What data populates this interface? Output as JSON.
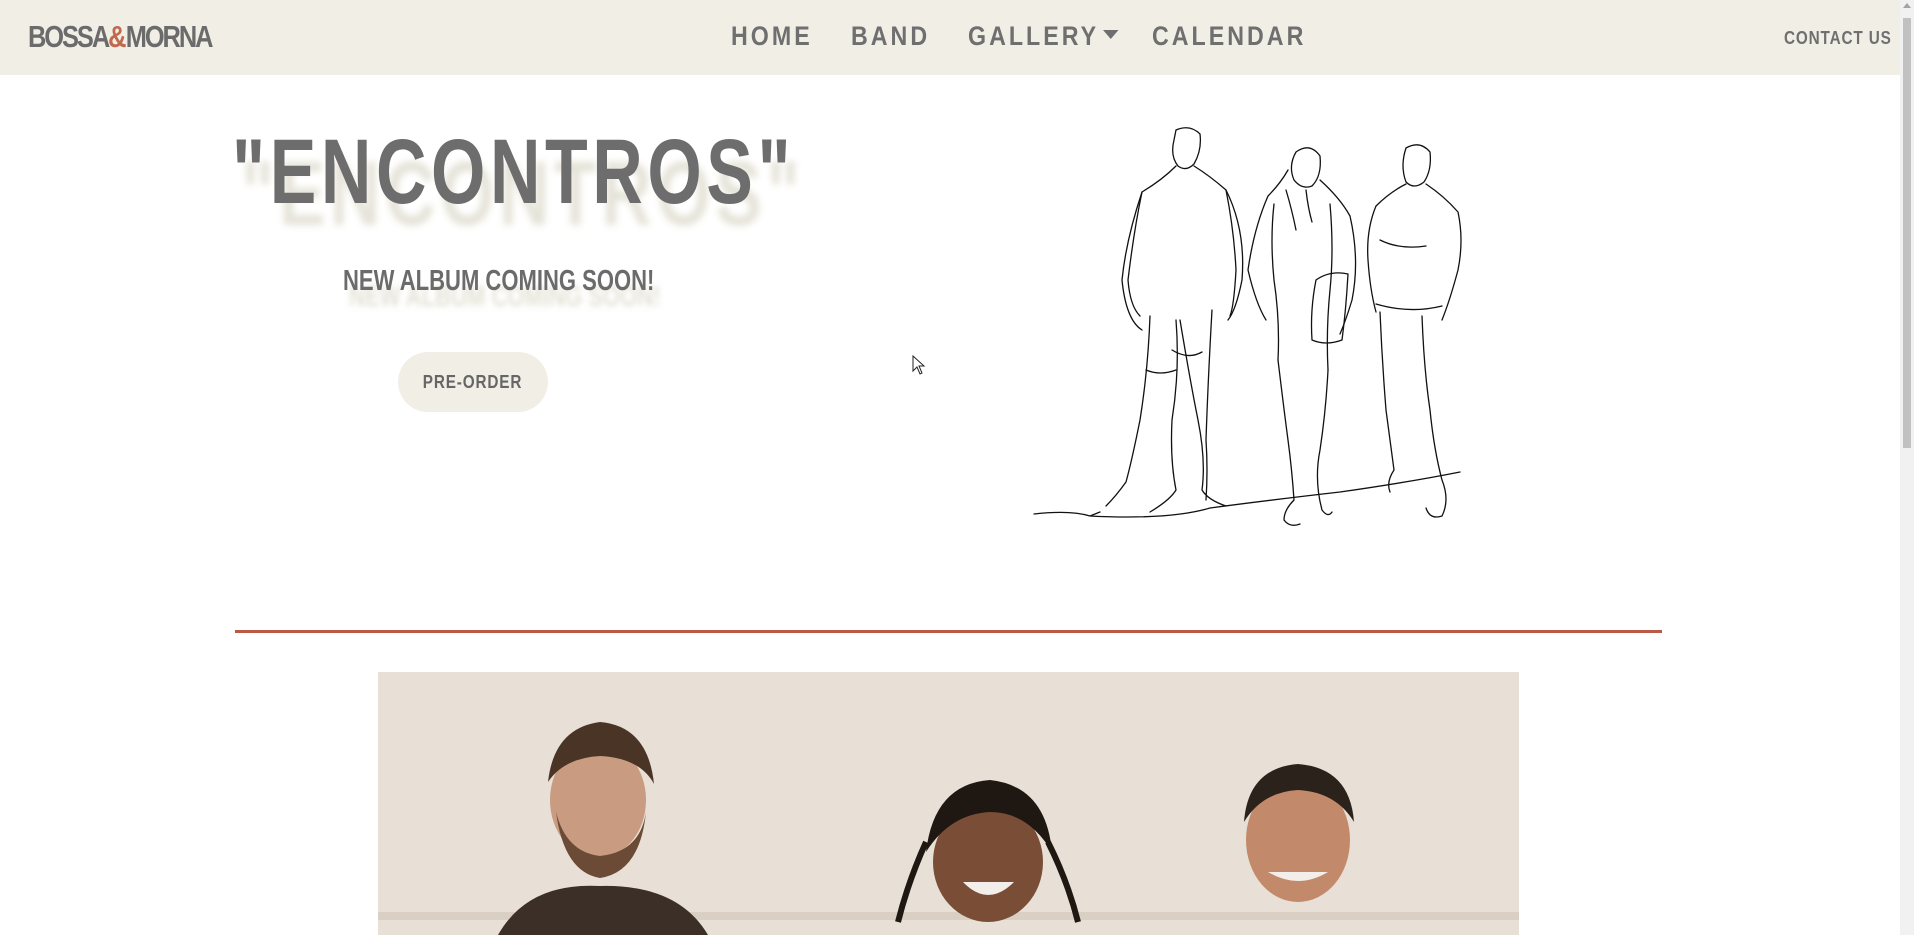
{
  "navbar": {
    "logo": {
      "part1": "BOSSA",
      "amp": "&",
      "part2": "MORNA"
    },
    "links": [
      {
        "label": "HOME"
      },
      {
        "label": "BAND"
      },
      {
        "label": "GALLERY"
      },
      {
        "label": "CALENDAR"
      }
    ],
    "contact_label": "CONTACT US"
  },
  "hero": {
    "title": "\"ENCONTROS\"",
    "subtitle": "NEW ALBUM COMING SOON!",
    "button_label": "PRE-ORDER"
  },
  "colors": {
    "nav_bg": "#f1eee6",
    "text": "#6d6d6d",
    "accent": "#c0694e",
    "divider": "#b85a45"
  },
  "icons": {
    "gallery_dropdown": "chevron-down-icon",
    "cursor": "mouse-cursor-icon"
  }
}
